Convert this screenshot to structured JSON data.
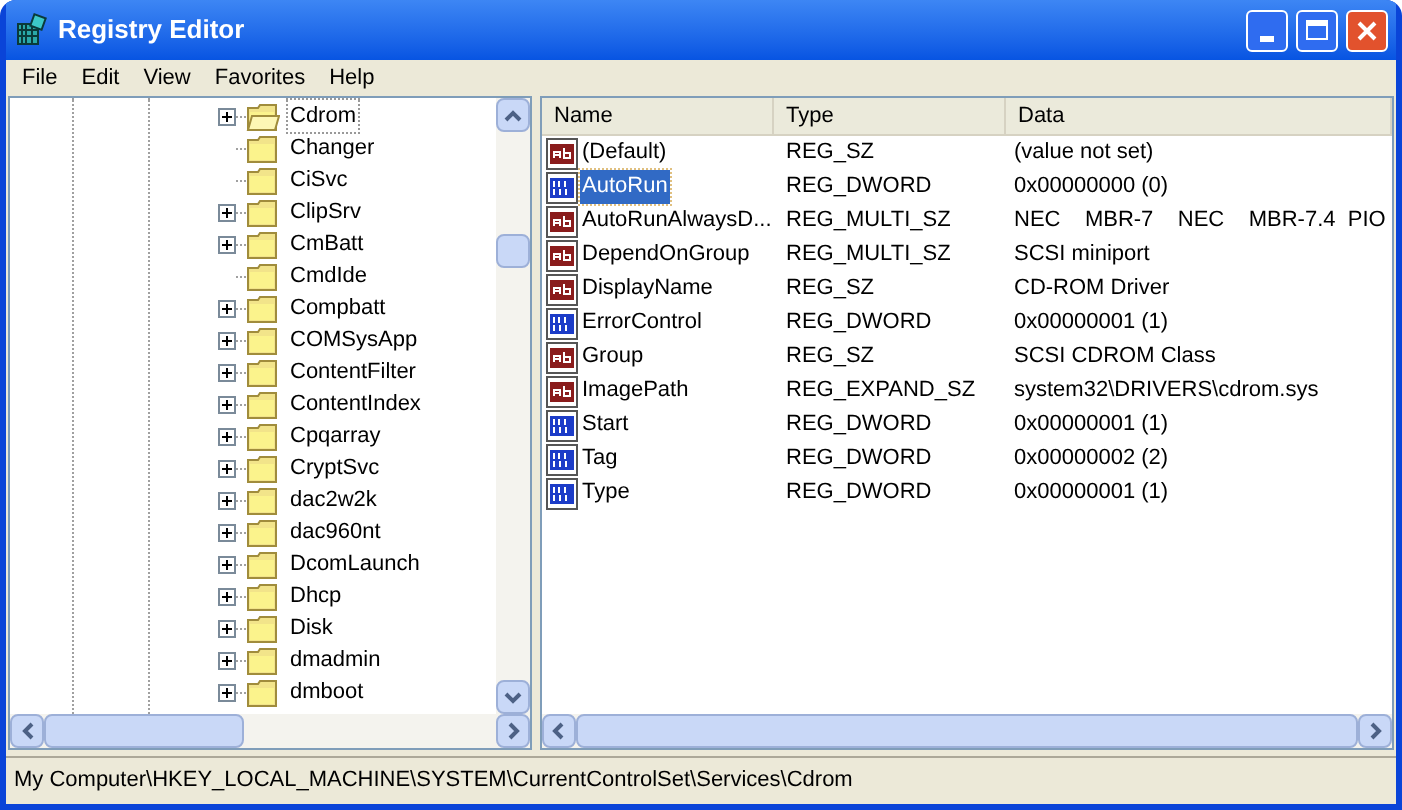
{
  "window": {
    "title": "Registry Editor"
  },
  "menu": [
    "File",
    "Edit",
    "View",
    "Favorites",
    "Help"
  ],
  "tree": {
    "items": [
      {
        "label": "Cdrom",
        "expandable": true,
        "selected": true
      },
      {
        "label": "Changer",
        "expandable": false,
        "selected": false
      },
      {
        "label": "CiSvc",
        "expandable": false,
        "selected": false
      },
      {
        "label": "ClipSrv",
        "expandable": true,
        "selected": false
      },
      {
        "label": "CmBatt",
        "expandable": true,
        "selected": false
      },
      {
        "label": "CmdIde",
        "expandable": false,
        "selected": false
      },
      {
        "label": "Compbatt",
        "expandable": true,
        "selected": false
      },
      {
        "label": "COMSysApp",
        "expandable": true,
        "selected": false
      },
      {
        "label": "ContentFilter",
        "expandable": true,
        "selected": false
      },
      {
        "label": "ContentIndex",
        "expandable": true,
        "selected": false
      },
      {
        "label": "Cpqarray",
        "expandable": true,
        "selected": false
      },
      {
        "label": "CryptSvc",
        "expandable": true,
        "selected": false
      },
      {
        "label": "dac2w2k",
        "expandable": true,
        "selected": false
      },
      {
        "label": "dac960nt",
        "expandable": true,
        "selected": false
      },
      {
        "label": "DcomLaunch",
        "expandable": true,
        "selected": false
      },
      {
        "label": "Dhcp",
        "expandable": true,
        "selected": false
      },
      {
        "label": "Disk",
        "expandable": true,
        "selected": false
      },
      {
        "label": "dmadmin",
        "expandable": true,
        "selected": false
      },
      {
        "label": "dmboot",
        "expandable": true,
        "selected": false
      }
    ]
  },
  "values": {
    "columns": [
      "Name",
      "Type",
      "Data"
    ],
    "rows": [
      {
        "kind": "string",
        "name": "(Default)",
        "type": "REG_SZ",
        "data": "(value not set)",
        "selected": false
      },
      {
        "kind": "binary",
        "name": "AutoRun",
        "type": "REG_DWORD",
        "data": "0x00000000 (0)",
        "selected": true
      },
      {
        "kind": "string",
        "name": "AutoRunAlwaysD...",
        "type": "REG_MULTI_SZ",
        "data": "NEC    MBR-7    NEC    MBR-7.4  PIO",
        "selected": false
      },
      {
        "kind": "string",
        "name": "DependOnGroup",
        "type": "REG_MULTI_SZ",
        "data": "SCSI miniport",
        "selected": false
      },
      {
        "kind": "string",
        "name": "DisplayName",
        "type": "REG_SZ",
        "data": "CD-ROM Driver",
        "selected": false
      },
      {
        "kind": "binary",
        "name": "ErrorControl",
        "type": "REG_DWORD",
        "data": "0x00000001 (1)",
        "selected": false
      },
      {
        "kind": "string",
        "name": "Group",
        "type": "REG_SZ",
        "data": "SCSI CDROM Class",
        "selected": false
      },
      {
        "kind": "string",
        "name": "ImagePath",
        "type": "REG_EXPAND_SZ",
        "data": "system32\\DRIVERS\\cdrom.sys",
        "selected": false
      },
      {
        "kind": "binary",
        "name": "Start",
        "type": "REG_DWORD",
        "data": "0x00000001 (1)",
        "selected": false
      },
      {
        "kind": "binary",
        "name": "Tag",
        "type": "REG_DWORD",
        "data": "0x00000002 (2)",
        "selected": false
      },
      {
        "kind": "binary",
        "name": "Type",
        "type": "REG_DWORD",
        "data": "0x00000001 (1)",
        "selected": false
      }
    ]
  },
  "status_bar": "My Computer\\HKEY_LOCAL_MACHINE\\SYSTEM\\CurrentControlSet\\Services\\Cdrom"
}
